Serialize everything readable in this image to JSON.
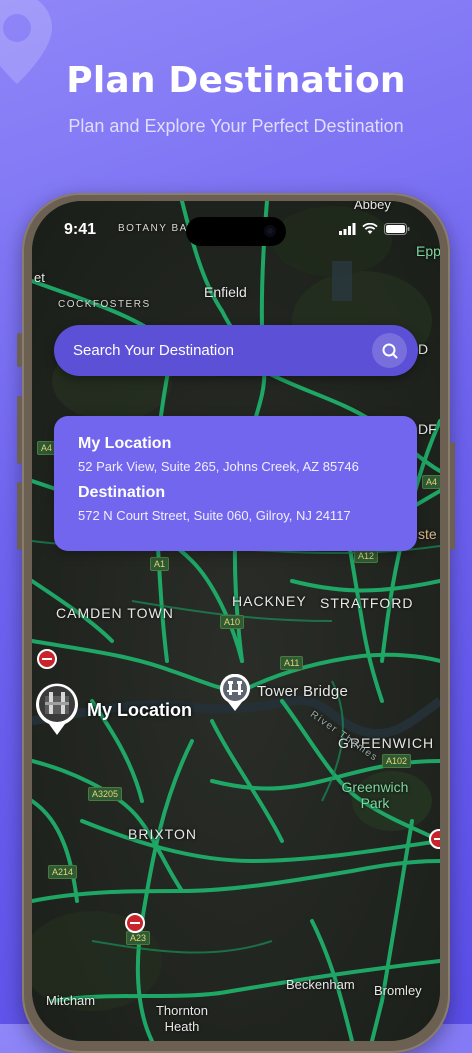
{
  "header": {
    "title": "Plan Destination",
    "subtitle": "Plan and Explore Your Perfect Destination"
  },
  "status_bar": {
    "time": "9:41"
  },
  "search": {
    "placeholder": "Search Your Destination"
  },
  "route_card": {
    "origin_label": "My Location",
    "origin_address": "52 Park View, Suite 265, Johns Creek, AZ 85746",
    "destination_label": "Destination",
    "destination_address": "572 N Court Street, Suite 060, Gilroy, NJ 24117"
  },
  "map": {
    "current_location_label": "My Location",
    "poi_label": "Tower Bridge",
    "places": {
      "botany_bay": "BOTANY BAY",
      "abbey": "Abbey",
      "epp": "Epp",
      "et": "et",
      "enfield": "Enfield",
      "cockfosters": "COCKFOSTERS",
      "d": "D",
      "edmonton": "EDMONTON",
      "df": "DF",
      "ste": "ste",
      "camden_town": "CAMDEN TOWN",
      "hackney": "HACKNEY",
      "stratford": "STRATFORD",
      "greenwich": "GREENWICH",
      "greenwich_park": "Greenwich Park",
      "river_thames": "River Thames",
      "brixton": "BRIXTON",
      "mitcham": "Mitcham",
      "thornton_heath": "Thornton Heath",
      "beckenham": "Beckenham",
      "bromley": "Bromley"
    },
    "roads": {
      "a4": "A4",
      "a12": "A12",
      "a1": "A1",
      "a10": "A10",
      "a11": "A11",
      "a102": "A102",
      "a3205": "A3205",
      "a214": "A214",
      "a23": "A23"
    }
  },
  "colors": {
    "background_gradient_start": "#8f86f8",
    "background_gradient_end": "#5a4ee8",
    "search_bar": "#5b50d6",
    "route_card": "#7266ef",
    "road_green": "#1fae6a",
    "phone_frame": "#6b6052"
  },
  "icons": {
    "search": "search-icon",
    "signal": "cellular-signal-icon",
    "wifi": "wifi-icon",
    "battery": "battery-icon",
    "location_pin": "location-pin-icon",
    "landmark": "landmark-icon",
    "no_entry": "no-entry-icon"
  }
}
